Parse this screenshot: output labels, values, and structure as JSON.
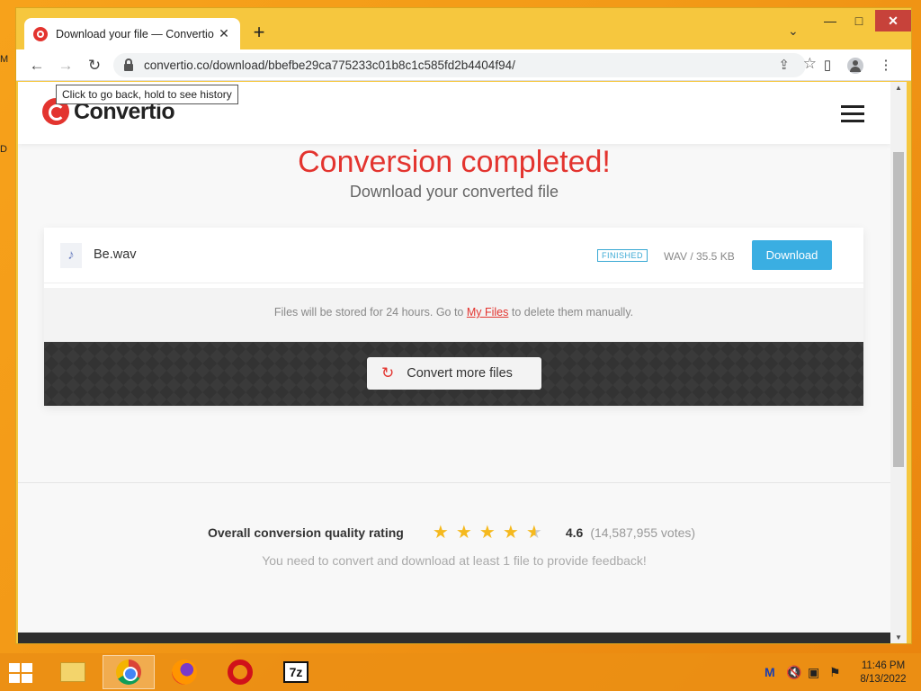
{
  "desktop": {
    "left_letters": [
      "M",
      "D"
    ]
  },
  "browser": {
    "tab_title": "Download your file — Convertio",
    "tab_close": "✕",
    "new_tab": "+",
    "tabs_menu": "⌄",
    "window_controls": {
      "minimize": "—",
      "maximize": "□",
      "close": "✕"
    },
    "nav": {
      "back": "←",
      "forward": "→",
      "reload": "↻"
    },
    "url": "convertio.co/download/bbefbe29ca775233c01b8c1c585fd2b4404f94/",
    "tooltip": "Click to go back, hold to see history",
    "icons": {
      "share": "⇪",
      "bookmark": "☆",
      "side_panel": "▯",
      "menu": "⋮"
    }
  },
  "site": {
    "brand": "Convertio",
    "accent_color": "#e3342f",
    "headline": "Conversion completed!",
    "subhead": "Download your converted file",
    "file": {
      "icon": "♪",
      "name": "Be.wav",
      "status": "FINISHED",
      "meta": "WAV / 35.5 KB",
      "download_label": "Download"
    },
    "storage_note": {
      "before": "Files will be stored for 24 hours. Go to ",
      "link": "My Files",
      "after": " to delete them manually."
    },
    "convert_more_label": "Convert more files",
    "rating": {
      "label": "Overall conversion quality rating",
      "value": 4.6,
      "score": "4.6",
      "votes": "(14,587,955 votes)",
      "feedback_note": "You need to convert and download at least 1 file to provide feedback!"
    }
  },
  "taskbar": {
    "apps": [
      "file-explorer",
      "chrome",
      "firefox",
      "opera",
      "7-zip"
    ],
    "sevenzip_label": "7z",
    "clock_time": "11:46 PM",
    "clock_date": "8/13/2022"
  }
}
